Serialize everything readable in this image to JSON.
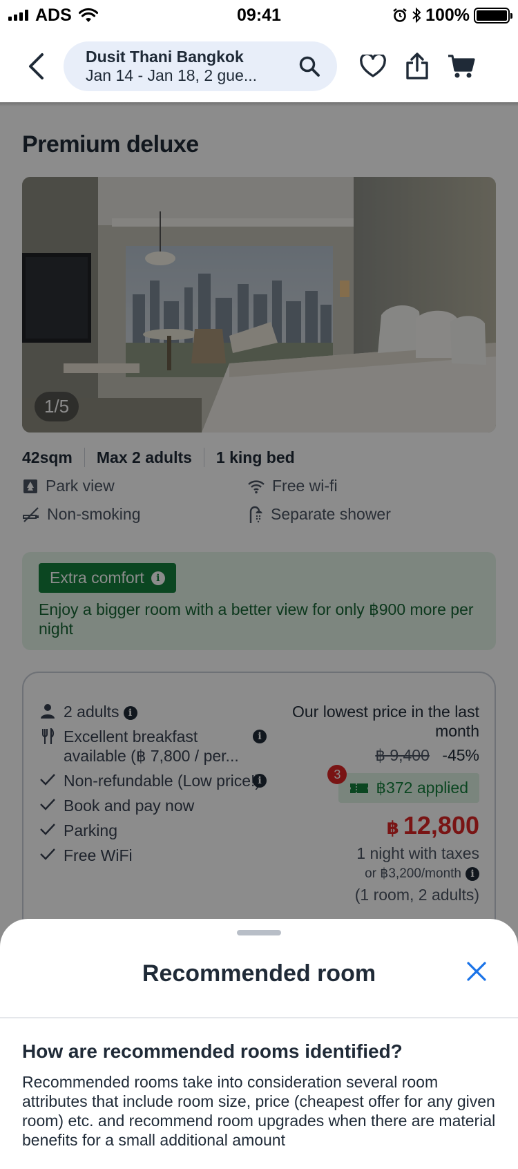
{
  "status_bar": {
    "carrier": "ADS",
    "time": "09:41",
    "battery": "100%"
  },
  "header": {
    "hotel_name": "Dusit Thani Bangkok",
    "dates_guests": "Jan 14 - Jan 18, 2 gue..."
  },
  "room": {
    "title": "Premium deluxe",
    "photo_counter": "1/5",
    "specs": [
      "42sqm",
      "Max 2 adults",
      "1 king bed"
    ],
    "amenities": [
      {
        "icon": "park-view-icon",
        "label": "Park view"
      },
      {
        "icon": "wifi-icon",
        "label": "Free wi-fi"
      },
      {
        "icon": "no-smoking-icon",
        "label": "Non-smoking"
      },
      {
        "icon": "shower-icon",
        "label": "Separate shower"
      }
    ]
  },
  "promo": {
    "badge": "Extra comfort",
    "text": "Enjoy a bigger room with a better view for only ฿900 more per night"
  },
  "offer": {
    "perks": [
      {
        "icon": "person-icon",
        "label": "2 adults",
        "info": true
      },
      {
        "icon": "cutlery-icon",
        "label": "Excellent breakfast available (฿ 7,800 / per...",
        "info": true
      },
      {
        "icon": "check-icon",
        "label": "Non-refundable (Low price!)",
        "info": true
      },
      {
        "icon": "check-icon",
        "label": "Book and pay now",
        "info": false
      },
      {
        "icon": "check-icon",
        "label": "Parking",
        "info": false
      },
      {
        "icon": "check-icon",
        "label": "Free WiFi",
        "info": false
      }
    ],
    "lowest_label": "Our lowest price in the last month",
    "old_price": "฿ 9,400",
    "discount": "-45%",
    "coupon_count": "3",
    "coupon_label": "฿372 applied",
    "currency": "฿",
    "price": "12,800",
    "price_note": "1 night with taxes",
    "monthly": "or ฿3,200/month",
    "occupancy": "(1 room, 2 adults)"
  },
  "sheet": {
    "title": "Recommended room",
    "question": "How are recommended rooms identified?",
    "answer": "Recommended rooms take into consideration several room attributes that include room size, price (cheapest offer for any given room) etc. and recommend room upgrades when there are material benefits for a small additional amount"
  },
  "colors": {
    "accent_blue": "#1a73e8",
    "price_red": "#dc2626",
    "promo_green": "#15803d"
  }
}
